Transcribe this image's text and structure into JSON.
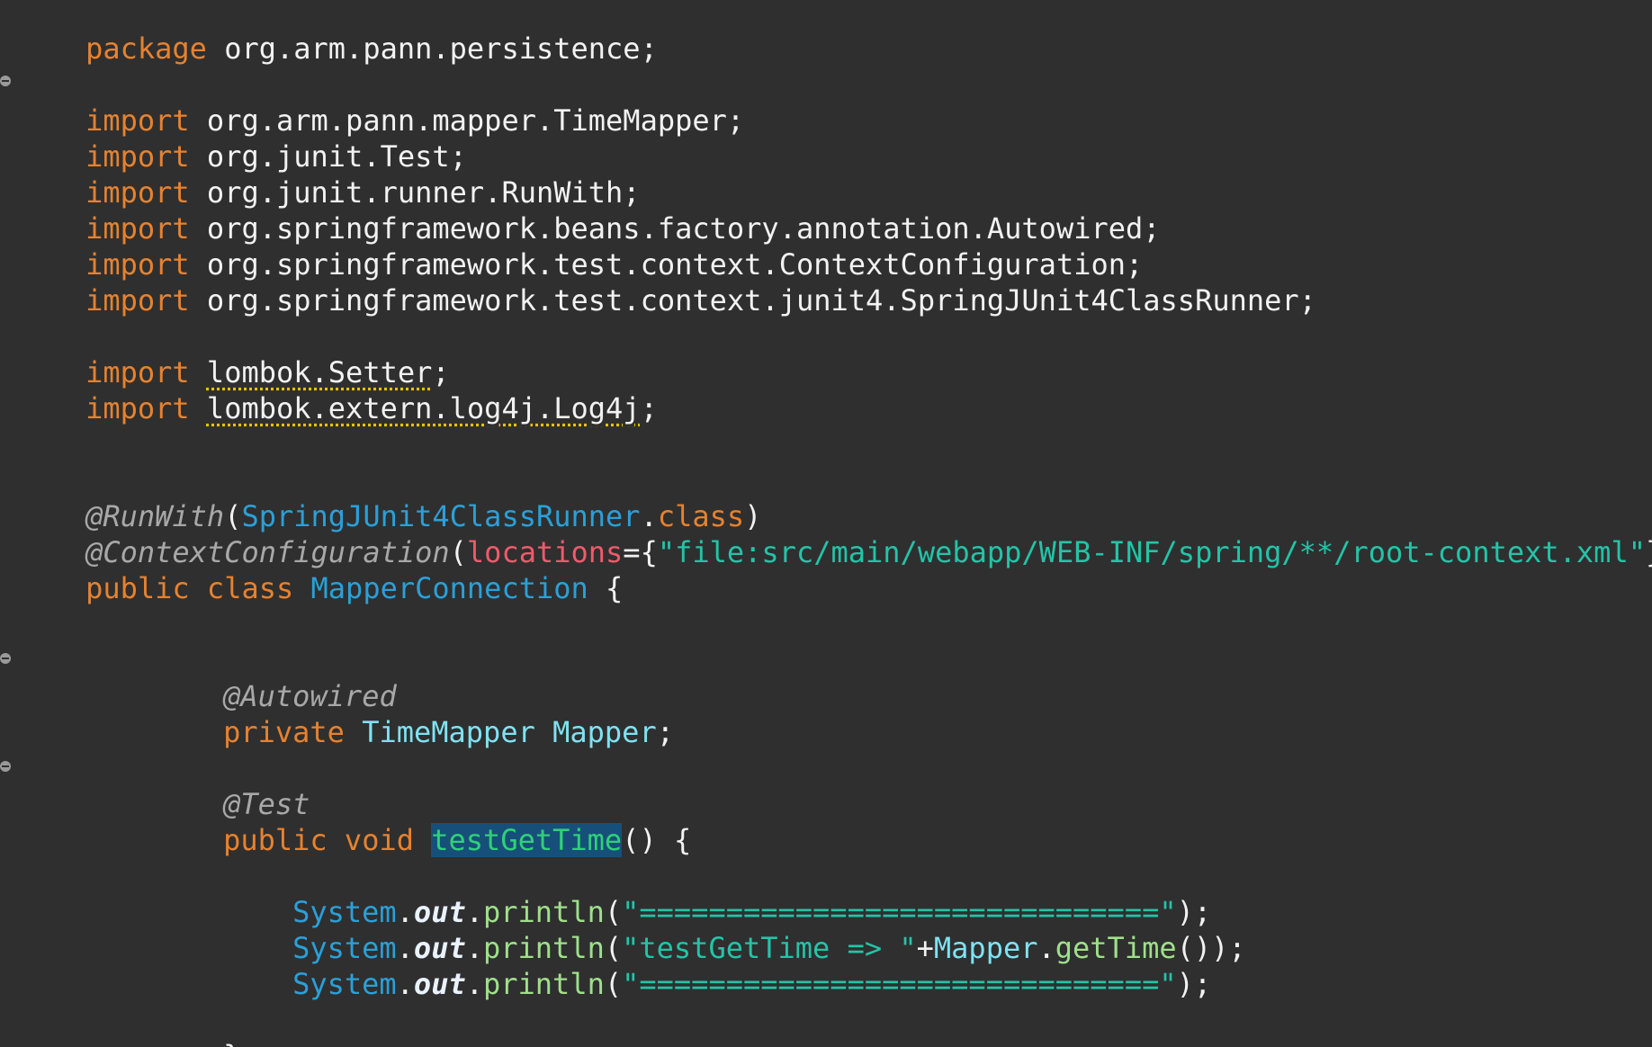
{
  "editor": {
    "package_kw": "package",
    "package_name": "org.arm.pann.persistence;",
    "import_kw": "import",
    "imports": [
      "org.arm.pann.mapper.TimeMapper;",
      "org.junit.Test;",
      "org.junit.runner.RunWith;",
      "org.springframework.beans.factory.annotation.Autowired;",
      "org.springframework.test.context.ContextConfiguration;",
      "org.springframework.test.context.junit4.SpringJUnit4ClassRunner;"
    ],
    "lombok_imports": [
      {
        "name": "lombok.Setter",
        "semi": ";"
      },
      {
        "name": "lombok.extern.log4j.Log4j",
        "semi": ";"
      }
    ],
    "runwith": {
      "annotation": "@RunWith",
      "open": "(",
      "type": "SpringJUnit4ClassRunner",
      "dot": ".",
      "class_kw": "class",
      "close": ")"
    },
    "context": {
      "annotation": "@ContextConfiguration",
      "open": "(",
      "param": "locations",
      "eq": "={",
      "value": "\"file:src/main/webapp/WEB-INF/spring/**/root-context.xml\"",
      "close": "})"
    },
    "class_decl": {
      "public_kw": "public",
      "class_kw": "class",
      "name": "MapperConnection",
      "brace": "{"
    },
    "field": {
      "annotation": "@Autowired",
      "private_kw": "private",
      "type": "TimeMapper",
      "name": "Mapper",
      "semi": ";"
    },
    "method": {
      "annotation": "@Test",
      "public_kw": "public",
      "void_kw": "void",
      "name": "testGetTime",
      "rest": "() {"
    },
    "println_lines": [
      {
        "system": "System",
        "dot1": ".",
        "out": "out",
        "dot2": ".",
        "println": "println",
        "open": "(",
        "arg": "\"==============================\"",
        "close": ");"
      },
      {
        "system": "System",
        "dot1": ".",
        "out": "out",
        "dot2": ".",
        "println": "println",
        "open": "(",
        "arg": "\"testGetTime => \"",
        "plus": "+",
        "obj": "Mapper",
        "dot3": ".",
        "call": "getTime",
        "close": "());"
      },
      {
        "system": "System",
        "dot1": ".",
        "out": "out",
        "dot2": ".",
        "println": "println",
        "open": "(",
        "arg": "\"==============================\"",
        "close": ");"
      }
    ],
    "close_brace": "}"
  }
}
